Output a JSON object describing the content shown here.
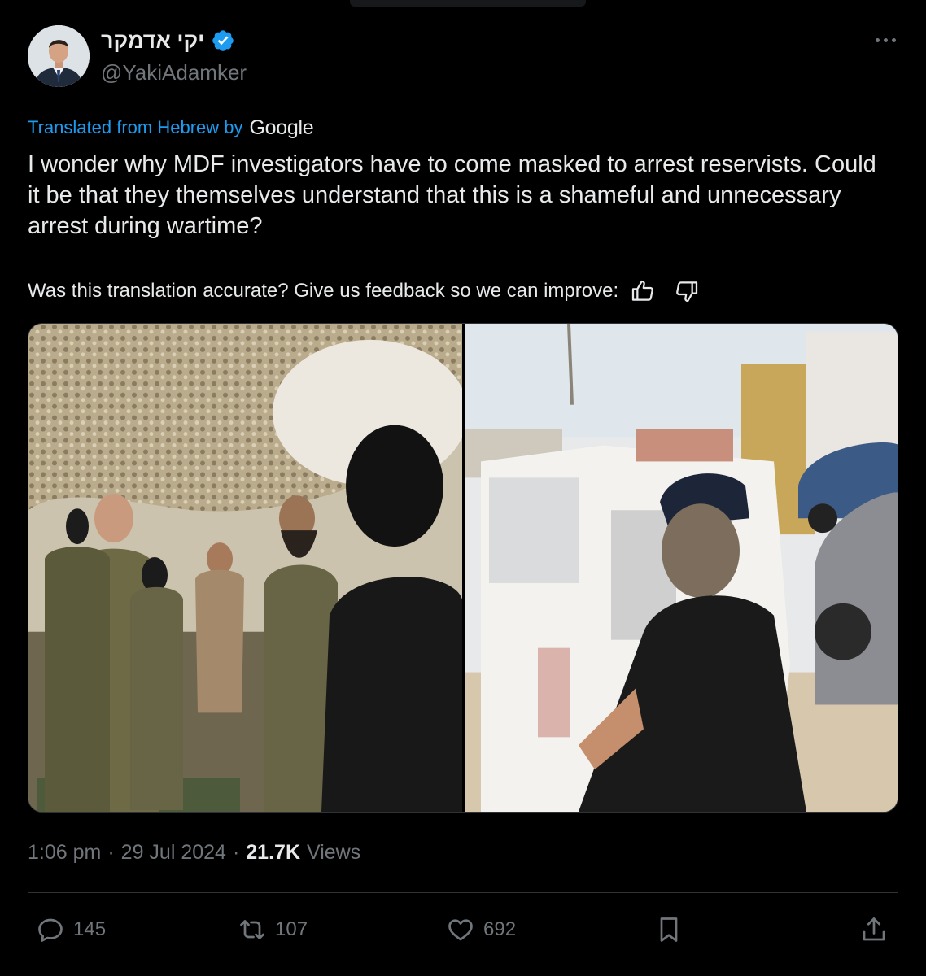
{
  "author": {
    "display_name": "יקי אדמקר",
    "handle": "@YakiAdamker",
    "verified_icon": "verified-badge-icon",
    "verified_color": "#1d9bf0"
  },
  "translation": {
    "label": "Translated from Hebrew by",
    "provider": "Google"
  },
  "tweet": {
    "text": "I wonder why MDF investigators have to come masked to arrest reservists. Could it be that they themselves understand that this is a shameful and unnecessary arrest during wartime?"
  },
  "feedback": {
    "prompt": "Was this translation accurate? Give us feedback so we can improve:"
  },
  "meta": {
    "time": "1:06 pm",
    "date": "29 Jul 2024",
    "separator": "·",
    "views_count": "21.7K",
    "views_label": "Views"
  },
  "actions": {
    "replies": "145",
    "reposts": "107",
    "likes": "692"
  },
  "colors": {
    "background": "#000000",
    "text": "#e7e9ea",
    "secondary": "#71767b",
    "link": "#1d9bf0",
    "border": "#2f3336"
  }
}
